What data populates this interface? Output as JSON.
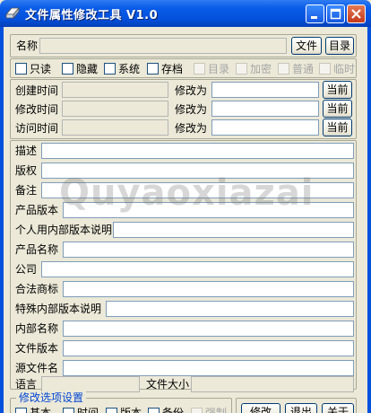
{
  "window": {
    "title": "文件属性修改工具 V1.0"
  },
  "row_name": {
    "label": "名称",
    "value": "",
    "file_btn": "文件",
    "dir_btn": "目录"
  },
  "attributes": [
    {
      "label": "只读",
      "enabled": true
    },
    {
      "label": "隐藏",
      "enabled": true
    },
    {
      "label": "系统",
      "enabled": true
    },
    {
      "label": "存档",
      "enabled": true
    },
    {
      "label": "目录",
      "enabled": false
    },
    {
      "label": "加密",
      "enabled": false
    },
    {
      "label": "普通",
      "enabled": false
    },
    {
      "label": "临时",
      "enabled": false
    }
  ],
  "times": [
    {
      "label": "创建时间",
      "value": "",
      "modify_label": "修改为",
      "new_value": "",
      "now_btn": "当前"
    },
    {
      "label": "修改时间",
      "value": "",
      "modify_label": "修改为",
      "new_value": "",
      "now_btn": "当前"
    },
    {
      "label": "访问时间",
      "value": "",
      "modify_label": "修改为",
      "new_value": "",
      "now_btn": "当前"
    }
  ],
  "info_fields": [
    {
      "label": "描述",
      "value": ""
    },
    {
      "label": "版权",
      "value": ""
    },
    {
      "label": "备注",
      "value": ""
    },
    {
      "label": "产品版本",
      "value": ""
    },
    {
      "label": "个人用内部版本说明",
      "value": ""
    },
    {
      "label": "产品名称",
      "value": ""
    },
    {
      "label": "公司",
      "value": ""
    },
    {
      "label": "合法商标",
      "value": ""
    },
    {
      "label": "特殊内部版本说明",
      "value": ""
    },
    {
      "label": "内部名称",
      "value": ""
    },
    {
      "label": "文件版本",
      "value": ""
    },
    {
      "label": "源文件名",
      "value": ""
    }
  ],
  "bottom_row": {
    "language_label": "语言",
    "language_value": "",
    "size_label": "文件大小",
    "size_value": ""
  },
  "options": {
    "title": "修改选项设置",
    "items": [
      {
        "label": "基本",
        "enabled": true
      },
      {
        "label": "时间",
        "enabled": true
      },
      {
        "label": "版本",
        "enabled": true
      },
      {
        "label": "备份",
        "enabled": true
      },
      {
        "label": "强制",
        "enabled": false
      }
    ]
  },
  "actions": {
    "modify": "修改",
    "exit": "退出",
    "about": "关于"
  },
  "watermark": "Quyaoxiazai",
  "colors": {
    "titlebar": "#0451dd",
    "face": "#ece9d8",
    "group_title": "#0046d5",
    "close": "#c4391a"
  }
}
